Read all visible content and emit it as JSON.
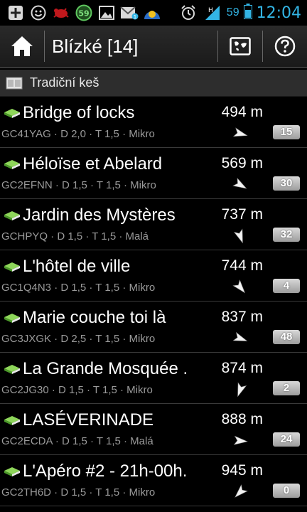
{
  "status_bar": {
    "icons": [
      "add-icon",
      "smiley-icon",
      "bug-icon",
      "counter-icon",
      "image-icon",
      "gmail-icon",
      "weather-icon",
      "alarm-icon",
      "signal-icon"
    ],
    "counter_value": "59",
    "battery_level": "59",
    "time": "12:04",
    "accent_color": "#33b5e5"
  },
  "action_bar": {
    "title": "Blízké [14]",
    "home_icon": "home-icon",
    "map_icon": "map-icon",
    "help_icon": "help-icon"
  },
  "section": {
    "label": "Tradiční keš",
    "icon": "traditional-cache-icon"
  },
  "caches": [
    {
      "name": "Bridge of locks",
      "meta": "GC41YAG · D 2,0 · T 1,5 · Mikro",
      "distance": "494 m",
      "count": "15",
      "bearing_deg": 105
    },
    {
      "name": "Héloïse et Abelard",
      "meta": "GC2EFNN · D 1,5 · T 1,5 · Mikro",
      "distance": "569 m",
      "count": "30",
      "bearing_deg": 120
    },
    {
      "name": "Jardin des Mystères",
      "meta": "GCHPYQ · D 1,5 · T 1,5 · Malá",
      "distance": "737 m",
      "count": "32",
      "bearing_deg": 160
    },
    {
      "name": "L'hôtel de ville",
      "meta": "GC1Q4N3 · D 1,5 · T 1,5 · Mikro",
      "distance": "744 m",
      "count": "4",
      "bearing_deg": 140
    },
    {
      "name": "Marie couche toi là",
      "meta": "GC3JXGK · D 2,5 · T 1,5 · Mikro",
      "distance": "837 m",
      "count": "48",
      "bearing_deg": 110
    },
    {
      "name": "La Grande Mosquée .",
      "meta": "GC2JG30 · D 1,5 · T 1,5 · Mikro",
      "distance": "874 m",
      "count": "2",
      "bearing_deg": 200
    },
    {
      "name": "LASÉVERINADE",
      "meta": "GC2ECDA · D 1,5 · T 1,5 · Malá",
      "distance": "888 m",
      "count": "24",
      "bearing_deg": 95
    },
    {
      "name": "L'Apéro #2 - 21h-00h.",
      "meta": "GC2TH6D · D 1,5 · T 1,5 · Mikro",
      "distance": "945 m",
      "count": "0",
      "bearing_deg": 225
    }
  ]
}
